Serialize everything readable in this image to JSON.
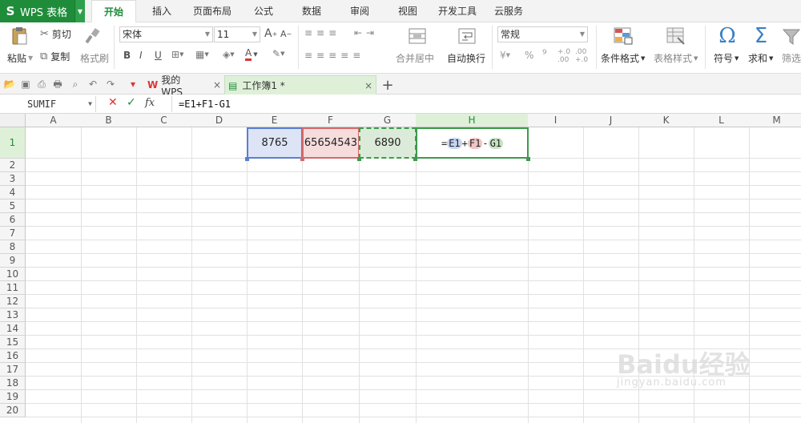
{
  "app": {
    "logo": "S",
    "title": "WPS 表格"
  },
  "menu": [
    "开始",
    "插入",
    "页面布局",
    "公式",
    "数据",
    "审阅",
    "视图",
    "开发工具",
    "云服务"
  ],
  "ribbon": {
    "paste": "粘贴",
    "cut": "剪切",
    "copy": "复制",
    "format_painter": "格式刷",
    "font_name": "宋体",
    "font_size": "11",
    "merge_center": "合并居中",
    "auto_wrap": "自动换行",
    "number_format": "常规",
    "percent": "%",
    "comma": "⁹",
    "inc_decimal": "+.0\n.00",
    "dec_decimal": ".00\n+.0",
    "conditional_format": "条件格式",
    "table_style": "表格样式",
    "symbol": "符号",
    "sum": "求和",
    "filter": "筛选"
  },
  "tabs": {
    "doc1": "我的WPS",
    "doc2": "工作簿1 *",
    "close": "×",
    "add": "+"
  },
  "formula_bar": {
    "name_box": "SUMIF",
    "formula": "=E1+F1-G1"
  },
  "grid": {
    "columns": [
      "A",
      "B",
      "C",
      "D",
      "E",
      "F",
      "G",
      "H",
      "I",
      "J",
      "K",
      "L",
      "M"
    ],
    "rows": [
      "1",
      "2",
      "3",
      "4",
      "5",
      "6",
      "7",
      "8",
      "9",
      "10",
      "11",
      "12",
      "13",
      "14",
      "15",
      "16",
      "17",
      "18",
      "19",
      "20"
    ],
    "cells": {
      "E1": "8765",
      "F1": "65654543",
      "G1": "6890"
    },
    "h1_formula": {
      "eq": "=",
      "ref1": "E1",
      "op1": "+",
      "ref2": "F1",
      "op2": "-",
      "ref3": "G1"
    }
  },
  "watermark": {
    "brand": "Baidu经验",
    "url": "jingyan.baidu.com"
  },
  "colors": {
    "accent_green": "#1f8c3a",
    "e1_fill": "#dce4f5",
    "f1_fill": "#f6dcdc",
    "g1_fill": "#dcebd9"
  }
}
